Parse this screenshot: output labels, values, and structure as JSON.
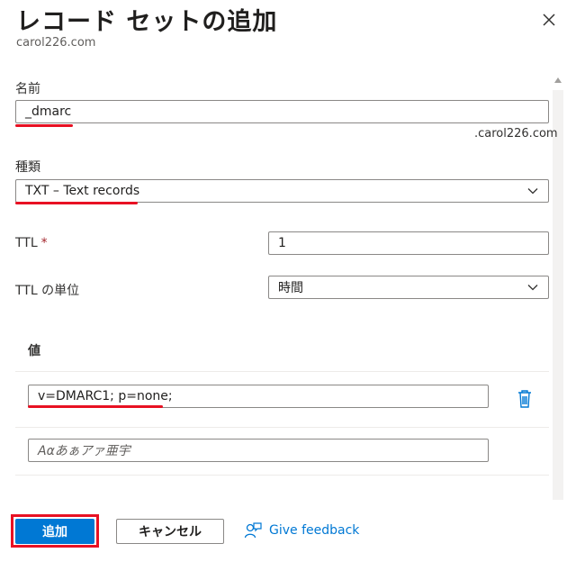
{
  "header": {
    "title": "レコード セットの追加",
    "subtitle": "carol226.com",
    "close_icon": "close-icon"
  },
  "form": {
    "name_label": "名前",
    "name_value": "_dmarc",
    "name_suffix": ".carol226.com",
    "type_label": "種類",
    "type_value": "TXT – Text records",
    "ttl_label": "TTL",
    "ttl_required": "*",
    "ttl_value": "1",
    "ttl_unit_label": "TTL の単位",
    "ttl_unit_value": "時間"
  },
  "values": {
    "header": "値",
    "items": [
      "v=DMARC1; p=none;"
    ],
    "new_placeholder": "Aαあぁアァ亜宇",
    "delete_icon": "trash-icon"
  },
  "footer": {
    "add_label": "追加",
    "cancel_label": "キャンセル",
    "feedback_label": "Give feedback",
    "feedback_icon": "feedback-icon"
  },
  "colors": {
    "accent": "#0078d4",
    "highlight": "#e81123",
    "required": "#a4262c"
  }
}
